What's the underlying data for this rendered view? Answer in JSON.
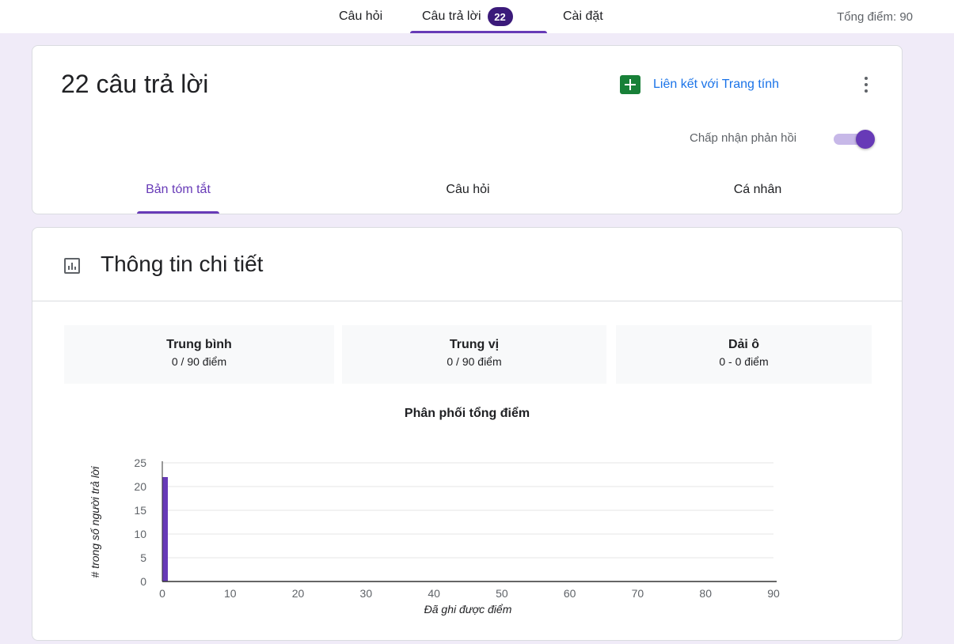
{
  "topbar": {
    "tabs": [
      {
        "label": "Câu hỏi"
      },
      {
        "label": "Câu trả lời",
        "badge": "22"
      },
      {
        "label": "Cài đặt"
      }
    ],
    "total_score": "Tổng điểm: 90"
  },
  "responses": {
    "title": "22 câu trả lời",
    "sheet_link": "Liên kết với Trang tính",
    "accept_label": "Chấp nhận phản hồi",
    "accepting": true,
    "tabs": [
      {
        "label": "Bản tóm tắt"
      },
      {
        "label": "Câu hỏi"
      },
      {
        "label": "Cá nhân"
      }
    ]
  },
  "insights": {
    "title": "Thông tin chi tiết",
    "stats": [
      {
        "title": "Trung bình",
        "value": "0 / 90 điểm"
      },
      {
        "title": "Trung vị",
        "value": "0 / 90 điểm"
      },
      {
        "title": "Dải ô",
        "value": "0 - 0 điểm"
      }
    ]
  },
  "colors": {
    "accent": "#673ab7",
    "badge": "#3b1a7a",
    "sheets_green": "#188038",
    "link_blue": "#1a73e8"
  },
  "chart_data": {
    "type": "bar",
    "title": "Phân phối tổng điểm",
    "xlabel": "Đã ghi được điểm",
    "ylabel": "# trong số người trả lời",
    "x": [
      0
    ],
    "values": [
      22
    ],
    "xlim": [
      0,
      90
    ],
    "ylim": [
      0,
      25
    ],
    "xticks": [
      "0",
      "10",
      "20",
      "30",
      "40",
      "50",
      "60",
      "70",
      "80",
      "90"
    ],
    "yticks": [
      "0",
      "5",
      "10",
      "15",
      "20",
      "25"
    ],
    "grid": true,
    "bar_color": "#673ab7"
  }
}
